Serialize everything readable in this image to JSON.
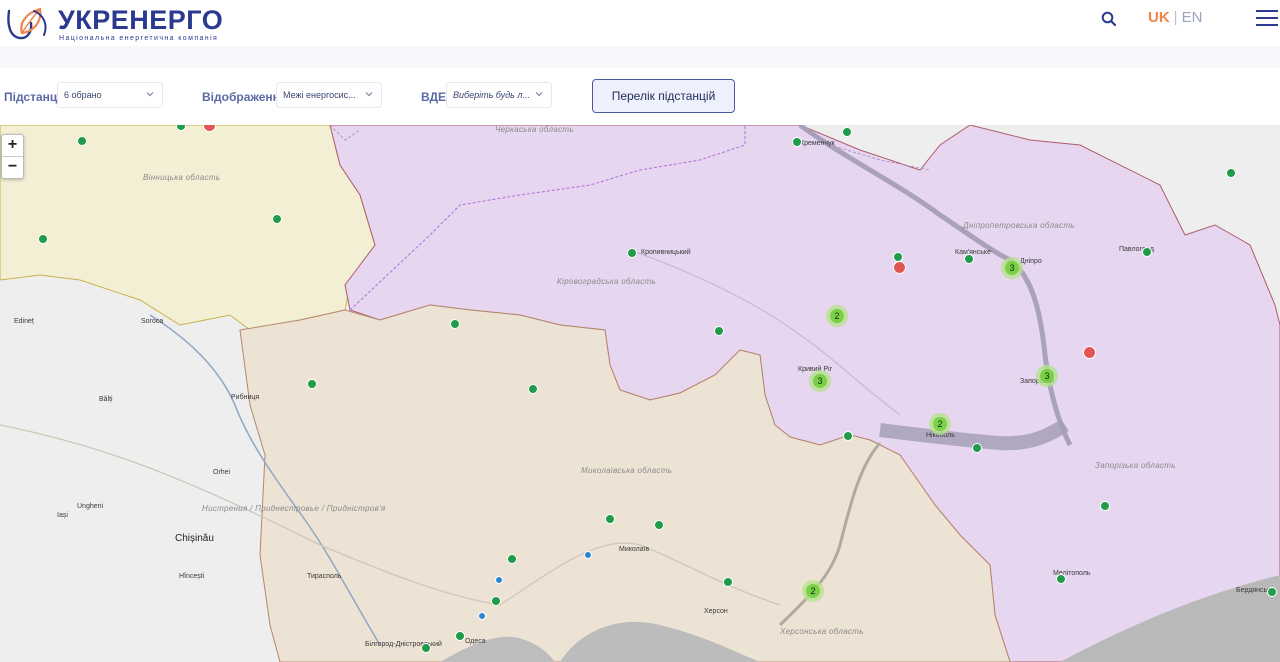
{
  "header": {
    "brand": "УКРЕНЕРГО",
    "tagline": "Національна енергетична компанія",
    "lang_uk": "UK",
    "lang_sep": "|",
    "lang_en": "EN",
    "icons": {
      "search": "search-icon",
      "menu": "hamburger-menu-icon",
      "logo": "ukrenergo-logo-icon"
    }
  },
  "filters": {
    "substations_label": "Підстанції",
    "substations_value": "6 обрано",
    "display_label": "Відображення",
    "display_value": "Межі енергосис...",
    "vde_label": "ВДЕ",
    "vde_value": "Виберіть будь л...",
    "list_button": "Перелік підстанцій"
  },
  "map": {
    "zoom_in": "+",
    "zoom_out": "−",
    "colors": {
      "green": "#1f9b4a",
      "blue": "#2a86d1",
      "red": "#e25555",
      "zone_purple": "#e6d6ef",
      "zone_yellow": "#f3efd4",
      "zone_tan": "#ede3d5"
    },
    "cities": {
      "kropyvnytskyi": "Кропивницький",
      "kremenchuk": "Кременчук",
      "kamianske": "Кам'янське",
      "dnipro": "Дніпро",
      "pavlohrad": "Павлоград",
      "kryvyi_rih": "Кривий Ріг",
      "zaporizhzhia": "Запоріжжя",
      "nikopol": "Нікополь",
      "melitopol": "Мелітополь",
      "berdiansk": "Бердянськ",
      "mykolaiv": "Миколаїв",
      "kherson": "Херсон",
      "odesa": "Одеса",
      "edinet": "Edineț",
      "soroca": "Soroca",
      "balti": "Bălți",
      "rybnytsia": "Рибниця",
      "orhei": "Orhei",
      "ungheni": "Ungheni",
      "iasi": "Iași",
      "chisinau": "Chișinău",
      "hincesti": "Hîncești",
      "tiraspol": "Тирасполь",
      "bilhorod": "Білгород-Дністровський"
    },
    "regions": {
      "cherkasy": "Черкаська область",
      "vinnytsia": "Вінницька область",
      "dnipropetrovsk": "Дніпропетровська область",
      "kirovohrad": "Кіровоградська область",
      "mykolaiv": "Миколаївська область",
      "zaporizhzhia": "Запорізька область",
      "kherson": "Херсонська область",
      "transnistria": "Нистрения / Приднестровье / Придністров'я"
    },
    "clusters": {
      "c1": "2",
      "c2": "3",
      "c3": "3",
      "c4": "3",
      "c5": "2",
      "c6": "2"
    }
  }
}
